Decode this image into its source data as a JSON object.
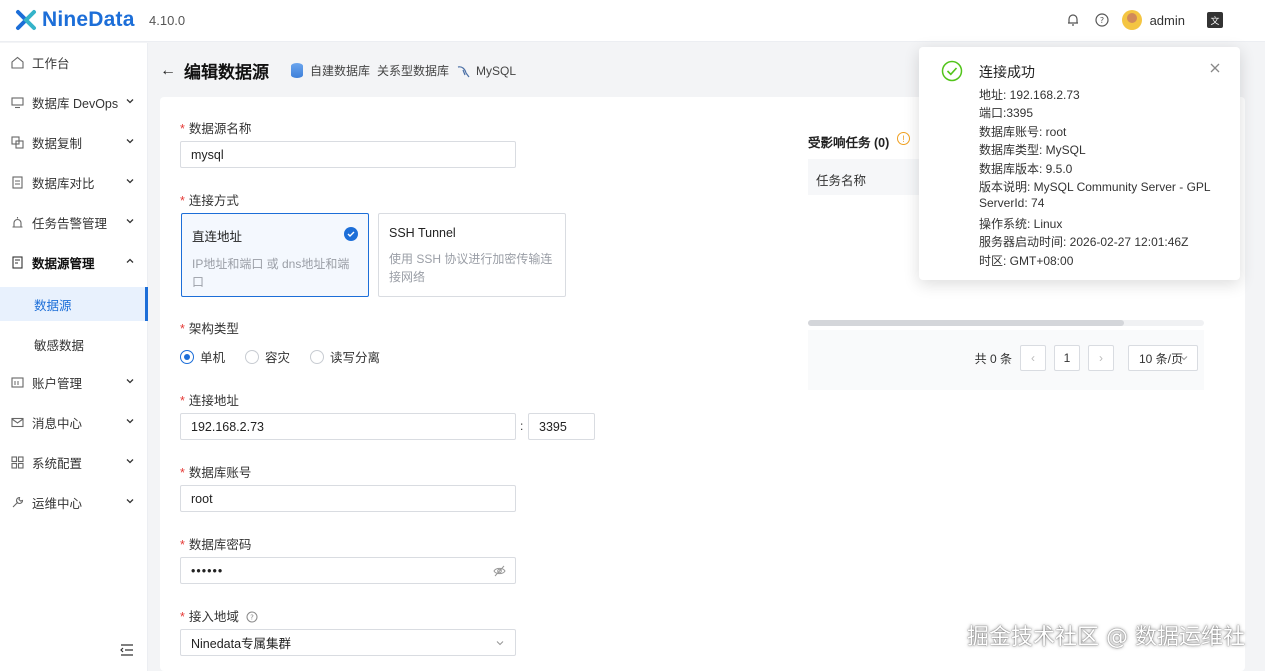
{
  "app": {
    "brand": "NineData",
    "version": "4.10.0",
    "username": "admin"
  },
  "sidebar": {
    "items": [
      {
        "label": "工作台"
      },
      {
        "label": "数据库 DevOps"
      },
      {
        "label": "数据复制"
      },
      {
        "label": "数据库对比"
      },
      {
        "label": "任务告警管理"
      },
      {
        "label": "数据源管理"
      },
      {
        "label": "账户管理"
      },
      {
        "label": "消息中心"
      },
      {
        "label": "系统配置"
      },
      {
        "label": "运维中心"
      }
    ],
    "sub_items": [
      {
        "label": "数据源"
      },
      {
        "label": "敏感数据"
      }
    ]
  },
  "header": {
    "title": "编辑数据源",
    "crumbs": [
      "自建数据库",
      "关系型数据库",
      "MySQL"
    ]
  },
  "form": {
    "name_label": "数据源名称",
    "name_value": "mysql",
    "conn_label": "连接方式",
    "conn_direct_title": "直连地址",
    "conn_direct_desc": "IP地址和端口 或 dns地址和端口",
    "conn_ssh_title": "SSH Tunnel",
    "conn_ssh_desc": "使用 SSH 协议进行加密传输连接网络",
    "arch_label": "架构类型",
    "arch_options": [
      "单机",
      "容灾",
      "读写分离"
    ],
    "addr_label": "连接地址",
    "addr_value": "192.168.2.73",
    "port_sep": ":",
    "port_value": "3395",
    "user_label": "数据库账号",
    "user_value": "root",
    "pwd_label": "数据库密码",
    "pwd_value": "••••••",
    "region_label": "接入地域",
    "region_value": "Ninedata专属集群"
  },
  "affected": {
    "title": "受影响任务 (0)",
    "col_name": "任务名称",
    "total": "共 0 条",
    "page": "1",
    "page_size": "10 条/页"
  },
  "notice": {
    "title": "连接成功",
    "lines": [
      "地址: 192.168.2.73",
      "端口:3395",
      "数据库账号: root",
      "数据库类型: MySQL",
      "数据库版本: 9.5.0",
      "版本说明: MySQL Community Server - GPL",
      "ServerId: 74",
      "操作系统: Linux",
      "服务器启动时间: 2026-02-27 12:01:46Z",
      "时区: GMT+08:00"
    ]
  },
  "watermark": "掘金技术社区 @ 数据运维社",
  "colors": {
    "accent": "#1c6ed8",
    "success": "#52c41a",
    "required": "#e53935"
  }
}
